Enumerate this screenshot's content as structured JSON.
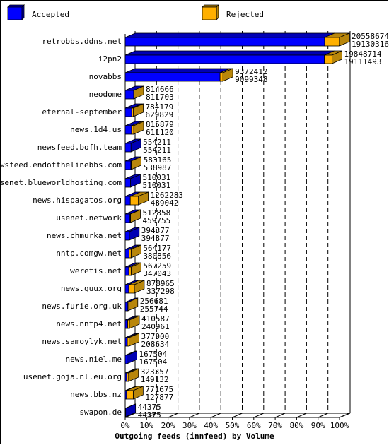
{
  "chart_data": {
    "type": "bar",
    "orientation": "horizontal",
    "stacked": true,
    "style": "3d",
    "title": "Outgoing feeds (innfeed) by Volume",
    "legend": {
      "placement": "top",
      "entries": [
        "Accepted",
        "Rejected"
      ]
    },
    "colors": {
      "accepted": "#0000ff",
      "rejected": "#ffb000"
    },
    "xlim": [
      0,
      100
    ],
    "x_ticks": [
      "0%",
      "10%",
      "20%",
      "30%",
      "40%",
      "50%",
      "60%",
      "70%",
      "80%",
      "90%",
      "100%"
    ],
    "grid": true,
    "categories": [
      "retrobbs.ddns.net",
      "i2pn2",
      "novabbs",
      "neodome",
      "eternal-september",
      "news.1d4.us",
      "newsfeed.bofh.team",
      "newsfeed.endofthelinebbs.com",
      "usenet.blueworldhosting.com",
      "news.hispagatos.org",
      "usenet.network",
      "news.chmurka.net",
      "nntp.comgw.net",
      "weretis.net",
      "news.quux.org",
      "news.furie.org.uk",
      "news.nntp4.net",
      "news.samoylyk.net",
      "news.niel.me",
      "usenet.goja.nl.eu.org",
      "news.bbs.nz",
      "swapon.de"
    ],
    "totals": [
      20558674,
      19848714,
      9372412,
      814666,
      784179,
      815879,
      554211,
      583165,
      510031,
      1262283,
      512858,
      394377,
      564177,
      567259,
      878965,
      256681,
      410587,
      377000,
      167504,
      323357,
      771675,
      44375
    ],
    "accepted": [
      19130316,
      19111493,
      9099348,
      811703,
      629829,
      611120,
      554211,
      538987,
      510031,
      489042,
      459755,
      394377,
      380856,
      347043,
      337298,
      255744,
      240961,
      208634,
      167504,
      149132,
      127877,
      44375
    ]
  }
}
